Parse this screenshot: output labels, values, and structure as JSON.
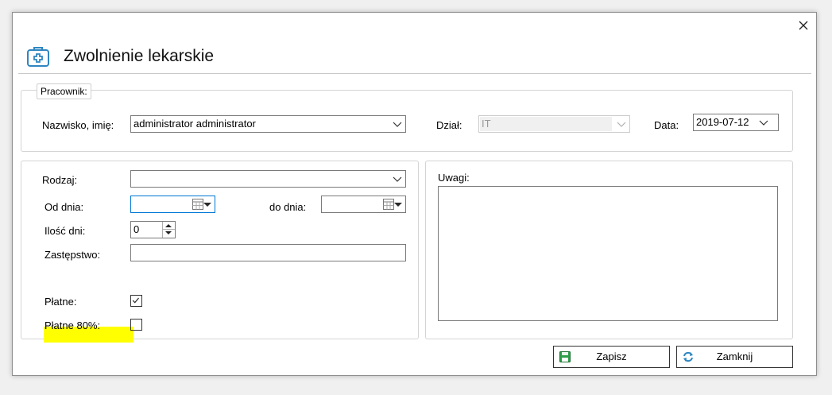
{
  "dialog": {
    "title": "Zwolnienie lekarskie",
    "close_glyph": "✕",
    "title_icon": "medical-kit-icon",
    "accent_color": "#2e86c1"
  },
  "employee_group": {
    "legend": "Pracownik:",
    "name_label": "Nazwisko, imię:",
    "name_value": "administrator administrator",
    "department_label": "Dział:",
    "department_value": "IT",
    "date_label": "Data:",
    "date_value": "2019-07-12"
  },
  "leave_group": {
    "type_label": "Rodzaj:",
    "type_value": "",
    "from_label": "Od dnia:",
    "from_value": "",
    "to_label": "do dnia:",
    "to_value": "",
    "days_label": "Ilość dni:",
    "days_value": "0",
    "substitute_label": "Zastępstwo:",
    "substitute_value": "",
    "paid_label": "Płatne:",
    "paid_checked": true,
    "paid80_label": "Płatne 80%:",
    "paid80_checked": false,
    "highlight_color": "#ffff00"
  },
  "notes_group": {
    "label": "Uwagi:",
    "value": ""
  },
  "buttons": {
    "save_label": "Zapisz",
    "save_icon": "floppy-disk-icon",
    "close_label": "Zamknij",
    "close_icon": "refresh-arrows-icon"
  }
}
